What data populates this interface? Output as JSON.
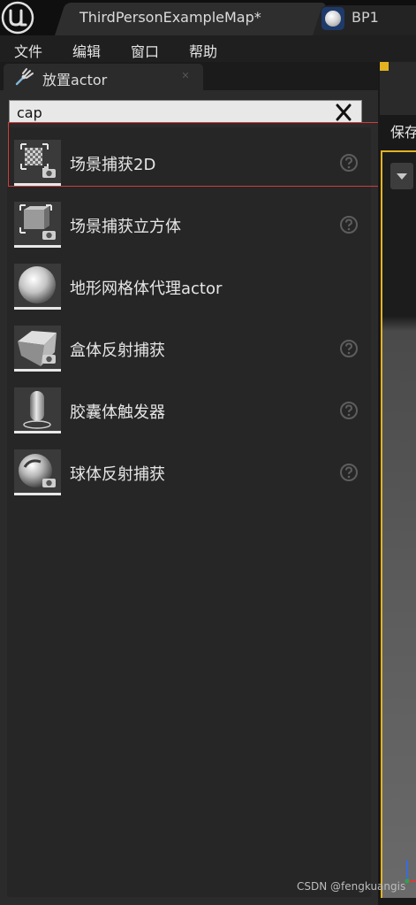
{
  "tabs": {
    "map_label": "ThirdPersonExampleMap*",
    "bp_label": "BP1"
  },
  "menu": [
    "文件",
    "编辑",
    "窗口",
    "帮助"
  ],
  "panel": {
    "title": "放置actor",
    "search": {
      "value": "cap"
    },
    "items": [
      {
        "label": "场景捕获2D",
        "icon": "scene-capture-2d-icon",
        "help": true
      },
      {
        "label": "场景捕获立方体",
        "icon": "scene-capture-cube-icon",
        "help": true
      },
      {
        "label": "地形网格体代理actor",
        "icon": "sphere-mesh-icon",
        "help": false
      },
      {
        "label": "盒体反射捕获",
        "icon": "box-reflection-capture-icon",
        "help": true
      },
      {
        "label": "胶囊体触发器",
        "icon": "capsule-trigger-icon",
        "help": true
      },
      {
        "label": "球体反射捕获",
        "icon": "sphere-reflection-capture-icon",
        "help": true
      }
    ]
  },
  "viewport": {
    "save_label": "保存"
  },
  "watermark": "CSDN @fengkuangis",
  "colors": {
    "highlight": "#d23c3c",
    "viewport_border": "#e3b320",
    "panel_bg": "#2b2b2b"
  }
}
